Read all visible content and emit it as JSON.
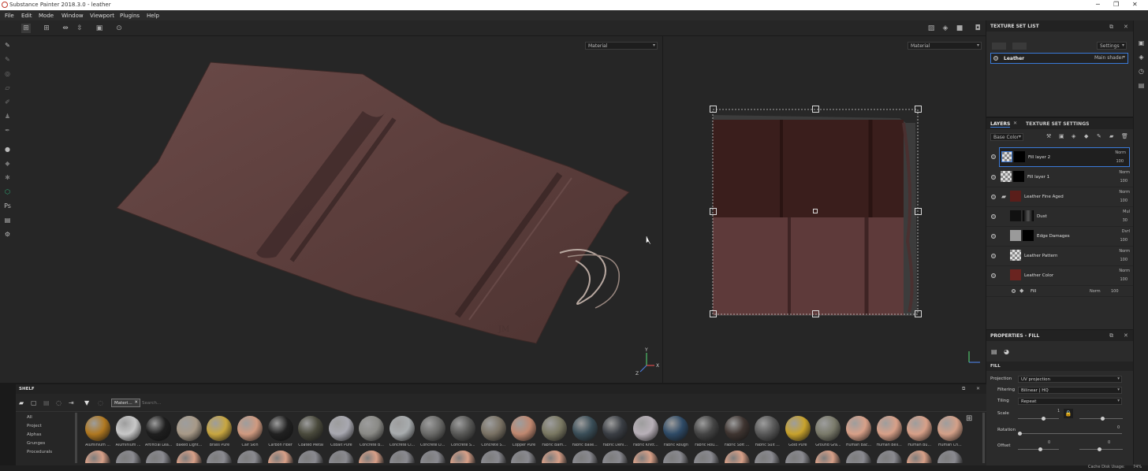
{
  "window": {
    "title": "Substance Painter 2018.3.0 - leather"
  },
  "menu": [
    "File",
    "Edit",
    "Mode",
    "Window",
    "Viewport",
    "Plugins",
    "Help"
  ],
  "viewport": {
    "mode3d": "Material",
    "mode2d": "Material"
  },
  "texture_set_list": {
    "title": "TEXTURE SET LIST",
    "settings": "Settings",
    "set_name": "Leather",
    "shader": "Main shader"
  },
  "layers_panel": {
    "tab_layers": "LAYERS",
    "tab_tss": "TEXTURE SET SETTINGS",
    "channel": "Base Color",
    "layers": [
      {
        "name": "Fill layer 2",
        "blend": "Norm",
        "opacity": "100"
      },
      {
        "name": "Fill layer 1",
        "blend": "Norm",
        "opacity": "100"
      },
      {
        "name": "Leather Fine Aged",
        "blend": "Norm",
        "opacity": "100"
      },
      {
        "name": "Dust",
        "blend": "Mul",
        "opacity": "30"
      },
      {
        "name": "Edge Damages",
        "blend": "Dvrl",
        "opacity": "100"
      },
      {
        "name": "Leather Pattern",
        "blend": "Norm",
        "opacity": "100"
      },
      {
        "name": "Leather Color",
        "blend": "Norm",
        "opacity": "100"
      }
    ],
    "fill_effect": {
      "name": "Fill",
      "blend": "Norm",
      "opacity": "100"
    }
  },
  "properties": {
    "title": "PROPERTIES - FILL",
    "section": "FILL",
    "projection_label": "Projection",
    "projection": "UV projection",
    "filtering_label": "Filtering",
    "filtering": "Bilinear | HQ",
    "tiling_label": "Tiling",
    "tiling": "Repeat",
    "scale_label": "Scale",
    "scale_val": "1",
    "rotation_label": "Rotation",
    "rotation_val": "0",
    "offset_label": "Offset",
    "offset_val1": "0",
    "offset_val2": "0"
  },
  "shelf": {
    "title": "SHELF",
    "filter_tag": "Materi...",
    "search_placeholder": "Search...",
    "categories": [
      "All",
      "Project",
      "Alphas",
      "Grunges",
      "Procedurals"
    ],
    "materials": [
      {
        "name": "Aluminium ...",
        "color": "#b07820"
      },
      {
        "name": "Aluminium ...",
        "color": "#c8c8c8"
      },
      {
        "name": "Artificial Lea...",
        "color": "#1e1e1e"
      },
      {
        "name": "Baked Light...",
        "color": "#a89a88"
      },
      {
        "name": "Brass Pure",
        "color": "#c8a640"
      },
      {
        "name": "Calf Skin",
        "color": "#d09a80"
      },
      {
        "name": "Carbon Fiber",
        "color": "#202020"
      },
      {
        "name": "Coated Metal",
        "color": "#4a4a3c"
      },
      {
        "name": "Cobalt Pure",
        "color": "#a8a8b0"
      },
      {
        "name": "Concrete B...",
        "color": "#8a8a86"
      },
      {
        "name": "Concrete Cl...",
        "color": "#a8acae"
      },
      {
        "name": "Concrete D...",
        "color": "#6a6a68"
      },
      {
        "name": "Concrete S...",
        "color": "#585856"
      },
      {
        "name": "Concrete S...",
        "color": "#7a7264"
      },
      {
        "name": "Copper Pure",
        "color": "#c08870"
      },
      {
        "name": "Fabric Bam...",
        "color": "#7a7862"
      },
      {
        "name": "Fabric Base...",
        "color": "#3a4e58"
      },
      {
        "name": "Fabric Deni...",
        "color": "#3a3e44"
      },
      {
        "name": "Fabric Knitt...",
        "color": "#b8b0b8"
      },
      {
        "name": "Fabric Rough",
        "color": "#2e4a66"
      },
      {
        "name": "Fabric Rou...",
        "color": "#444444"
      },
      {
        "name": "Fabric Soft ...",
        "color": "#3e3430"
      },
      {
        "name": "Fabric Suit ...",
        "color": "#585858"
      },
      {
        "name": "Gold Pure",
        "color": "#c8a22c"
      },
      {
        "name": "Ground Gra...",
        "color": "#7a7a6a"
      },
      {
        "name": "Human Bac...",
        "color": "#d8a088"
      },
      {
        "name": "Human Bell...",
        "color": "#d8a088"
      },
      {
        "name": "Human Bu...",
        "color": "#d8a088"
      },
      {
        "name": "Human Ch...",
        "color": "#d4a088"
      }
    ]
  },
  "status": {
    "cache_label": "Cache Disk Usage:",
    "cache_value": "74%"
  },
  "colors": {
    "accent": "#3a7ad8",
    "leather": "#5c3c3a"
  }
}
